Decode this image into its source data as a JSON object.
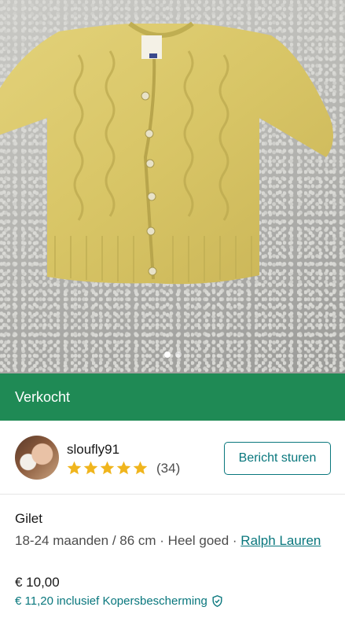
{
  "photo": {
    "alt": "Gilet",
    "slide_count": 2,
    "active_slide": 1
  },
  "status": {
    "label": "Verkocht",
    "color": "#1f8a55"
  },
  "seller": {
    "username": "sloufly91",
    "rating_stars": 5,
    "review_count": "(34)",
    "message_button": "Bericht sturen"
  },
  "item": {
    "title": "Gilet",
    "size": "18-24 maanden / 86 cm",
    "separator": " · ",
    "condition": "Heel goed",
    "brand": "Ralph Lauren",
    "price": "€ 10,00",
    "price_with_protection": "€ 11,20 inclusief Kopersbescherming"
  },
  "colors": {
    "accent": "#09777d",
    "star": "#f0b51d"
  },
  "icons": {
    "rating": "star-icon",
    "protection": "shield-check-icon"
  }
}
